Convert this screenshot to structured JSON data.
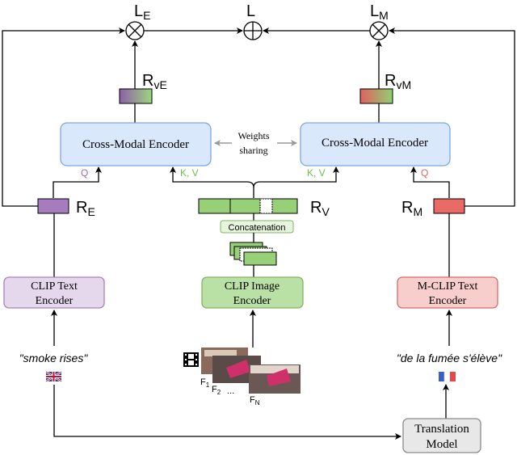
{
  "losses": {
    "le": "L",
    "le_sub": "E",
    "l": "L",
    "lm": "L",
    "lm_sub": "M"
  },
  "reps": {
    "rve": "R",
    "rve_sub": "vE",
    "rvm": "R",
    "rvm_sub": "vM",
    "re": "R",
    "re_sub": "E",
    "rv": "R",
    "rv_sub": "V",
    "rm": "R",
    "rm_sub": "M"
  },
  "encoders": {
    "cross_left": "Cross-Modal Encoder",
    "cross_right": "Cross-Modal Encoder",
    "weights_line1": "Weights",
    "weights_line2": "sharing",
    "clip_text_1": "CLIP Text",
    "clip_text_2": "Encoder",
    "clip_image_1": "CLIP Image",
    "clip_image_2": "Encoder",
    "mclip_text_1": "M-CLIP Text",
    "mclip_text_2": "Encoder",
    "concatenation": "Concatenation",
    "translation_1": "Translation",
    "translation_2": "Model"
  },
  "attention": {
    "q_left": "Q",
    "kv_left": "K, V",
    "kv_right": "K, V",
    "q_right": "Q"
  },
  "inputs": {
    "english": "\"smoke rises\"",
    "french": "\"de la fumée s'élève\"",
    "frames": [
      "F",
      "F",
      "...",
      "F"
    ],
    "frame_subs": [
      "1",
      "2",
      "",
      "N"
    ],
    "english_flag": "uk-flag-icon",
    "french_flag": "france-flag-icon"
  },
  "colors": {
    "text_enc": "#e6d8ec",
    "text_border": "#a883b8",
    "image_enc": "#b9e0a5",
    "image_border": "#82b366",
    "mclip_enc": "#f8cecc",
    "mclip_border": "#d66a6a",
    "cross": "#dae8fc",
    "cross_border": "#7ea6e0",
    "q_left": "#9b6bb5",
    "kv": "#6abf4b",
    "q_right": "#e06666"
  }
}
